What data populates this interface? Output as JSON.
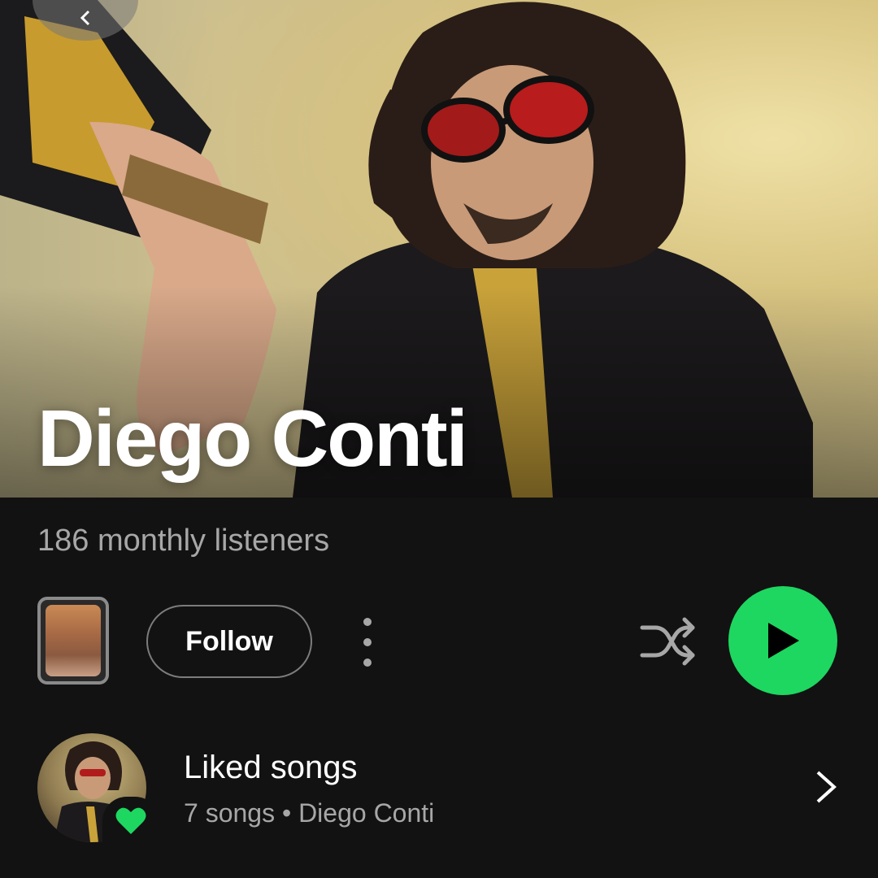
{
  "artist": {
    "name": "Diego Conti",
    "monthly_listeners": "186 monthly listeners"
  },
  "actions": {
    "follow_label": "Follow"
  },
  "liked_songs": {
    "title": "Liked songs",
    "subtitle": "7 songs • Diego Conti"
  },
  "icons": {
    "back": "chevron-left-icon",
    "more": "more-vertical-icon",
    "shuffle": "shuffle-icon",
    "play": "play-icon",
    "heart": "heart-icon",
    "chevron": "chevron-right-icon"
  },
  "colors": {
    "background": "#121212",
    "accent_green": "#1ed760",
    "secondary_text": "#a7a7a7"
  }
}
